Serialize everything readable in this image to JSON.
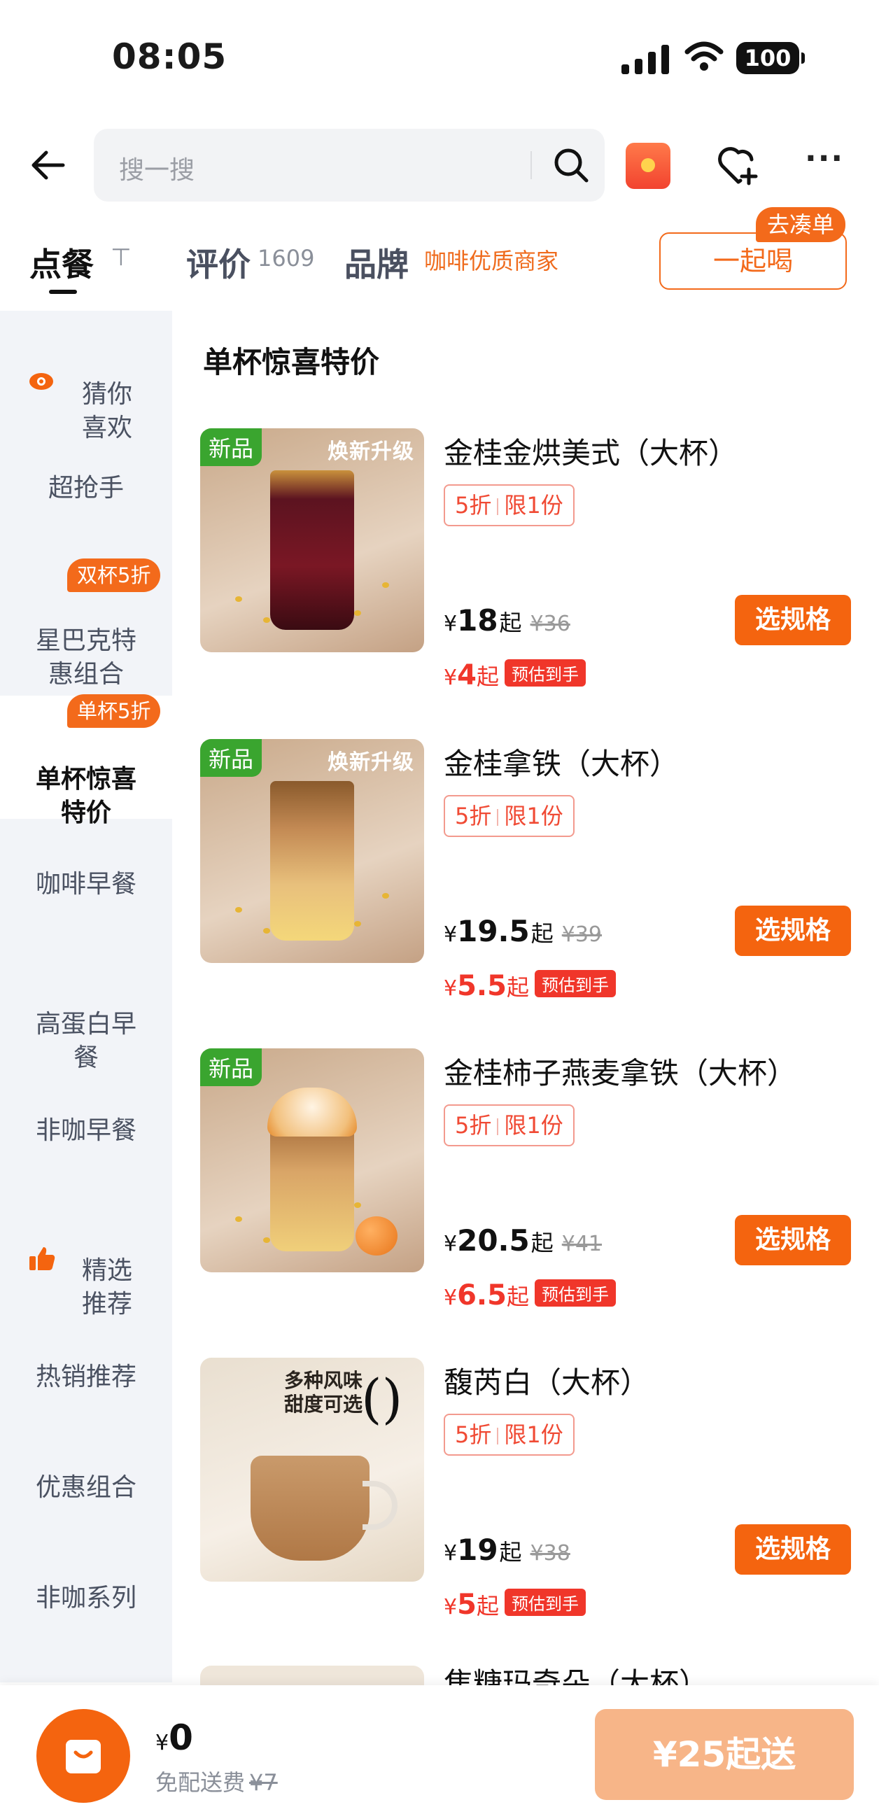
{
  "status_bar": {
    "time": "08:05",
    "battery": "100"
  },
  "header": {
    "search_placeholder": "搜一搜"
  },
  "tabs": {
    "order": "点餐",
    "review": "评价",
    "review_count": "1609",
    "brand": "品牌",
    "brand_tag": "咖啡优质商家",
    "drink_together": "一起喝",
    "join_badge": "去凑单"
  },
  "sidebar": {
    "items": [
      {
        "label": "猜你\n喜欢"
      },
      {
        "label": "超抢手"
      },
      {
        "label": "星巴克特\n惠组合",
        "badge": "双杯5折"
      },
      {
        "label": "单杯惊喜\n特价",
        "badge": "单杯5折",
        "active": true
      },
      {
        "label": "咖啡早餐"
      },
      {
        "label": "高蛋白早\n餐"
      },
      {
        "label": "非咖早餐"
      },
      {
        "label": "精选\n推荐"
      },
      {
        "label": "热销推荐"
      },
      {
        "label": "优惠组合"
      },
      {
        "label": "非咖系列"
      }
    ]
  },
  "section_title": "单杯惊喜特价",
  "products": [
    {
      "name": "金桂金烘美式（大杯）",
      "new_tag": "新品",
      "upgrade_tag": "焕新升级",
      "discount": "5折",
      "limit": "限1份",
      "currency": "¥",
      "price": "18",
      "from": "起",
      "orig_price": "¥36",
      "est_price": "4",
      "est_tag": "预估到手",
      "button": "选规格"
    },
    {
      "name": "金桂拿铁（大杯）",
      "new_tag": "新品",
      "upgrade_tag": "焕新升级",
      "discount": "5折",
      "limit": "限1份",
      "currency": "¥",
      "price": "19.5",
      "from": "起",
      "orig_price": "¥39",
      "est_price": "5.5",
      "est_tag": "预估到手",
      "button": "选规格"
    },
    {
      "name": "金桂柿子燕麦拿铁（大杯）",
      "new_tag": "新品",
      "upgrade_tag": "",
      "discount": "5折",
      "limit": "限1份",
      "currency": "¥",
      "price": "20.5",
      "from": "起",
      "orig_price": "¥41",
      "est_price": "6.5",
      "est_tag": "预估到手",
      "button": "选规格"
    },
    {
      "name": "馥芮白（大杯）",
      "new_tag": "",
      "upgrade_tag": "",
      "image_text": "多种风味\n甜度可选",
      "discount": "5折",
      "limit": "限1份",
      "currency": "¥",
      "price": "19",
      "from": "起",
      "orig_price": "¥38",
      "est_price": "5",
      "est_tag": "预估到手",
      "button": "选规格"
    }
  ],
  "peek_product": {
    "name": "焦糖玛奇朵（大杯）"
  },
  "bottom_bar": {
    "currency": "¥",
    "total": "0",
    "delivery_label": "免配送费",
    "delivery_orig": "¥7",
    "min_order": "¥25起送"
  },
  "colors": {
    "accent": "#f4640f",
    "price_red": "#f0362a",
    "new_green": "#3aa52f",
    "sidebar_bg": "#f2f4f8"
  }
}
